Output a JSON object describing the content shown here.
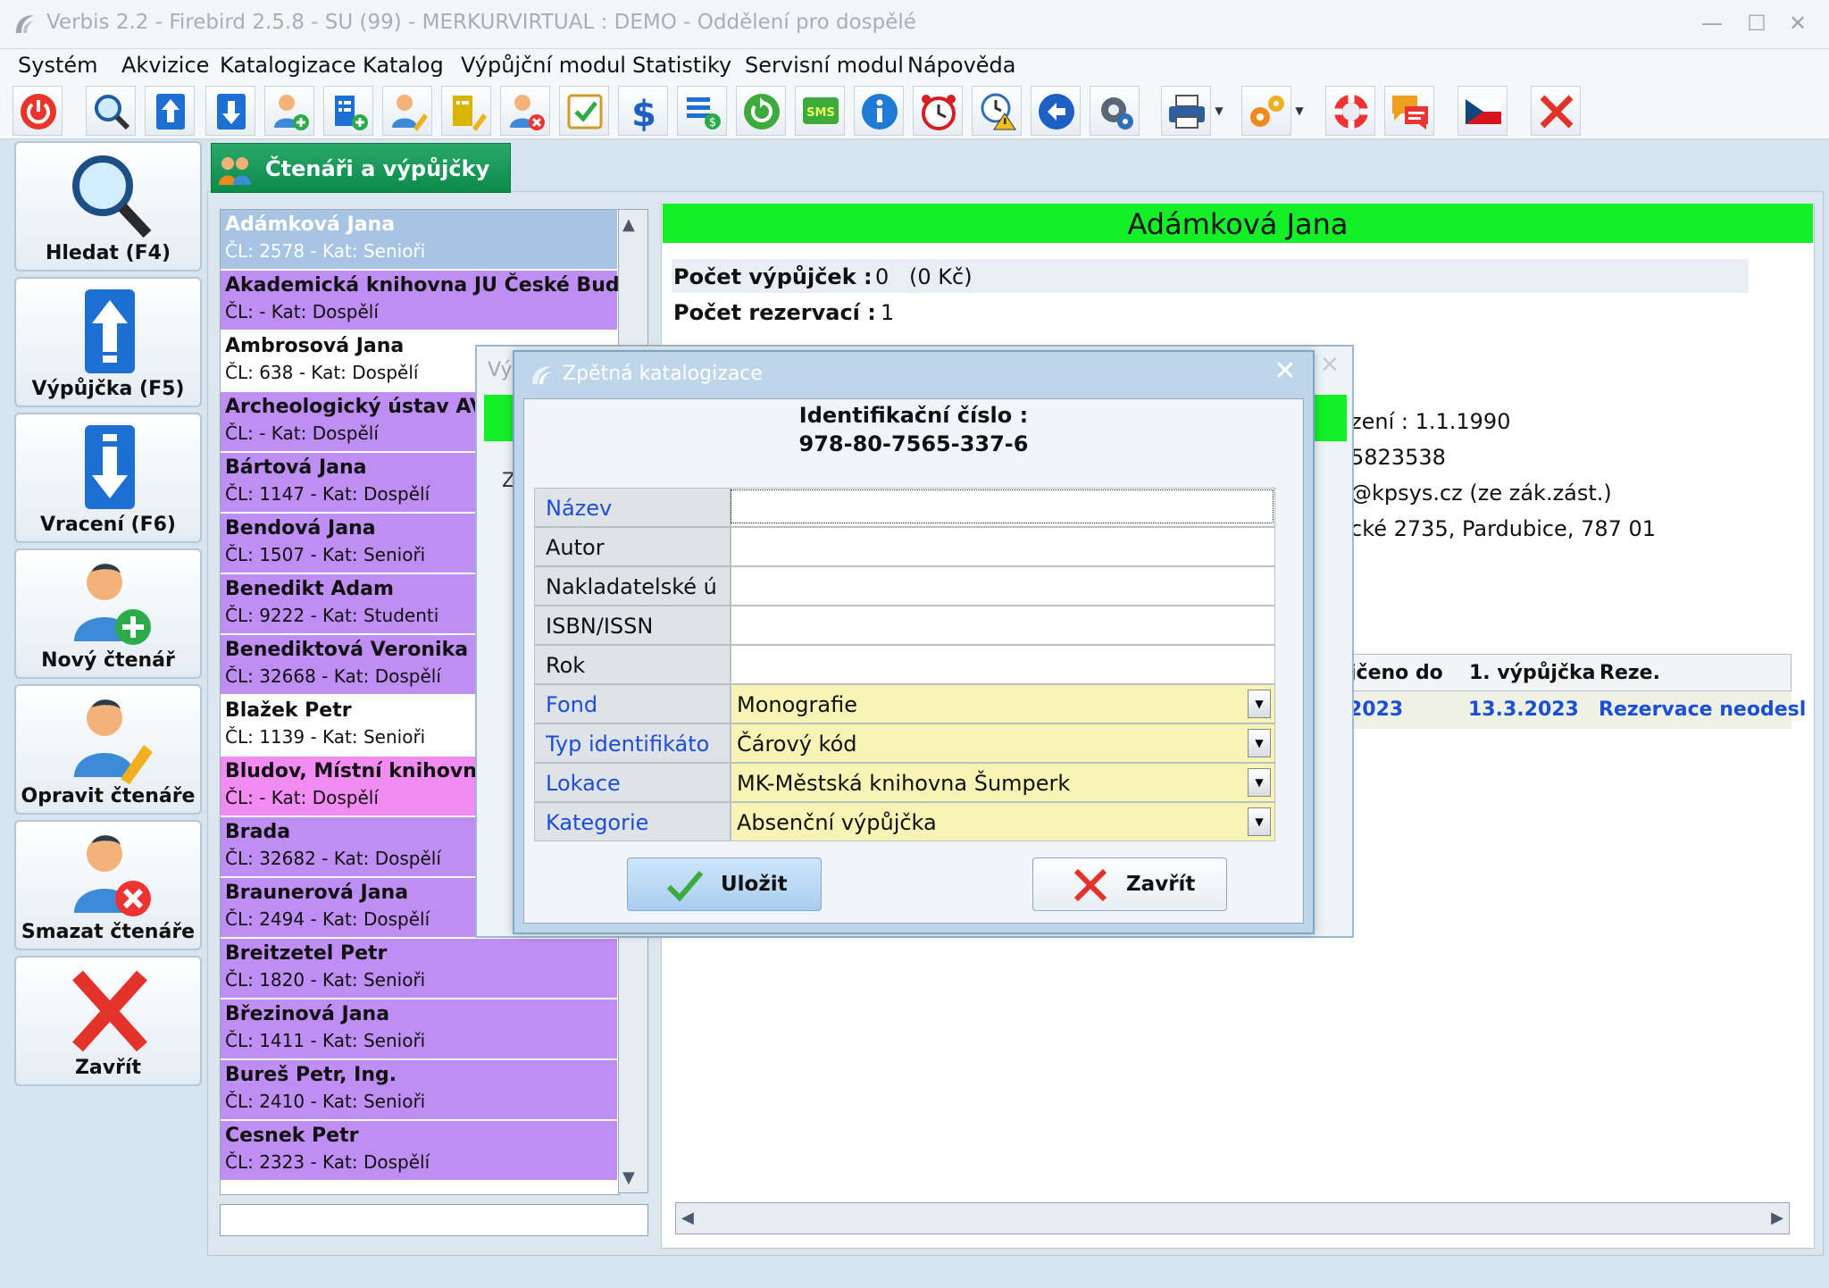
{
  "window": {
    "title": "Verbis 2.2 - Firebird 2.5.8 - SU (99) - MERKURVIRTUAL : DEMO - Oddělení pro dospělé"
  },
  "menu": [
    "Systém",
    "Akvizice",
    "Katalogizace",
    "Katalog",
    "Výpůjční modul",
    "Statistiky",
    "Servisní modul",
    "Nápověda"
  ],
  "toolbar": {
    "icons": [
      "power-icon",
      "search-icon",
      "checkout-icon",
      "return-icon",
      "add-reader-icon",
      "add-document-icon",
      "edit-reader-icon",
      "edit-document-icon",
      "delete-reader-icon",
      "checklist-icon",
      "dollar-icon",
      "fees-icon",
      "refresh-icon",
      "sms-icon",
      "info-icon",
      "alarm-clock-icon",
      "warning-clock-icon",
      "back-arrow-icon",
      "settings-icon",
      "printer-icon",
      "gears-icon",
      "lifebuoy-icon",
      "chat-icon",
      "czech-flag-icon",
      "close-icon"
    ],
    "sms_label": "SMS"
  },
  "left_buttons": {
    "search": "Hledat (F4)",
    "checkout": "Výpůjčka (F5)",
    "return": "Vracení (F6)",
    "new_reader": "Nový čtenář",
    "edit_reader": "Opravit čtenáře",
    "delete_reader": "Smazat čtenáře",
    "close": "Zavřít"
  },
  "tab": {
    "label": "Čtenáři a výpůjčky"
  },
  "readers": [
    {
      "name": "Adámková Jana",
      "meta": "ČL: 2578 - Kat: Senioři",
      "color": "#a8c4e4",
      "name_color": "#ffffff",
      "meta_color": "#ffffff"
    },
    {
      "name": "Akademická knihovna JU České Bud...",
      "meta": "ČL:  - Kat: Dospělí",
      "color": "#bf8ef4",
      "name_color": "#111111",
      "meta_color": "#111111"
    },
    {
      "name": "Ambrosová Jana",
      "meta": "ČL: 638 - Kat: Dospělí",
      "color": "#ffffff",
      "name_color": "#111111",
      "meta_color": "#111111"
    },
    {
      "name": "Archeologický ústav AV Č",
      "meta": "ČL:  - Kat: Dospělí",
      "color": "#bf8ef4",
      "name_color": "#111111",
      "meta_color": "#111111"
    },
    {
      "name": "Bártová Jana",
      "meta": "ČL: 1147 - Kat: Dospělí",
      "color": "#bf8ef4",
      "name_color": "#111111",
      "meta_color": "#111111"
    },
    {
      "name": "Bendová Jana",
      "meta": "ČL: 1507 - Kat: Senioři",
      "color": "#bf8ef4",
      "name_color": "#111111",
      "meta_color": "#111111"
    },
    {
      "name": "Benedikt Adam",
      "meta": "ČL: 9222 - Kat: Studenti",
      "color": "#bf8ef4",
      "name_color": "#111111",
      "meta_color": "#111111"
    },
    {
      "name": "Benediktová Veronika",
      "meta": "ČL: 32668 - Kat: Dospělí",
      "color": "#bf8ef4",
      "name_color": "#111111",
      "meta_color": "#111111"
    },
    {
      "name": "Blažek Petr",
      "meta": "ČL: 1139 - Kat: Senioři",
      "color": "#ffffff",
      "name_color": "#111111",
      "meta_color": "#111111"
    },
    {
      "name": "Bludov, Místní knihovna B",
      "meta": "ČL:  - Kat: Dospělí",
      "color": "#f28cf2",
      "name_color": "#111111",
      "meta_color": "#111111"
    },
    {
      "name": "Brada",
      "meta": "ČL: 32682 - Kat: Dospělí",
      "color": "#bf8ef4",
      "name_color": "#111111",
      "meta_color": "#111111"
    },
    {
      "name": "Braunerová Jana",
      "meta": "ČL: 2494 - Kat: Dospělí",
      "color": "#bf8ef4",
      "name_color": "#111111",
      "meta_color": "#111111"
    },
    {
      "name": "Breitzetel Petr",
      "meta": "ČL: 1820 - Kat: Senioři",
      "color": "#bf8ef4",
      "name_color": "#111111",
      "meta_color": "#111111"
    },
    {
      "name": "Březinová Jana",
      "meta": "ČL: 1411 - Kat: Senioři",
      "color": "#bf8ef4",
      "name_color": "#111111",
      "meta_color": "#111111"
    },
    {
      "name": "Bureš Petr, Ing.",
      "meta": "ČL: 2410 - Kat: Senioři",
      "color": "#bf8ef4",
      "name_color": "#111111",
      "meta_color": "#111111"
    },
    {
      "name": "Cesnek Petr",
      "meta": "ČL: 2323 - Kat: Dospělí",
      "color": "#bf8ef4",
      "name_color": "#111111",
      "meta_color": "#111111"
    }
  ],
  "reader_detail": {
    "name": "Adámková Jana",
    "loans_label": "Počet výpůjček :",
    "loans_value": "0",
    "loans_amount": "(0 Kč)",
    "reservations_label": "Počet rezervací :",
    "reservations_value": "1",
    "birth_partial": "zení : 1.1.1990",
    "phone_partial": "5823538",
    "email_partial": "@kpsys.cz (ze zák.zást.)",
    "address_partial": "cké 2735, Pardubice, 787 01"
  },
  "loans_grid": {
    "headers": [
      "jčeno do",
      "1. výpůjčka",
      "Reze."
    ],
    "row": [
      "2023",
      "13.3.2023",
      "Rezervace neodesl"
    ]
  },
  "dialog": {
    "title": "Zpětná katalogizace",
    "id_label": "Identifikační číslo :",
    "id_value": "978-80-7565-337-6",
    "fields": [
      {
        "label": "Název",
        "value": "",
        "required": true,
        "select": false
      },
      {
        "label": "Autor",
        "value": "",
        "required": false,
        "select": false
      },
      {
        "label": "Nakladatelské ú",
        "value": "",
        "required": false,
        "select": false
      },
      {
        "label": "ISBN/ISSN",
        "value": "",
        "required": false,
        "select": false
      },
      {
        "label": "Rok",
        "value": "",
        "required": false,
        "select": false
      },
      {
        "label": "Fond",
        "value": "Monografie",
        "required": true,
        "select": true
      },
      {
        "label": "Typ identifikáto",
        "value": "Čárový kód",
        "required": true,
        "select": true
      },
      {
        "label": "Lokace",
        "value": "MK-Městská knihovna Šumperk",
        "required": true,
        "select": true
      },
      {
        "label": "Kategorie",
        "value": "Absenční výpůjčka",
        "required": true,
        "select": true
      }
    ],
    "save_label": "Uložit",
    "close_label": "Zavřít"
  },
  "ghost_dialog": {
    "title_partial": "Vý",
    "letter": "Z"
  },
  "colors": {
    "accent_green": "#14f028",
    "required_label": "#1a4fd6",
    "select_bg": "#f8f4b6"
  }
}
